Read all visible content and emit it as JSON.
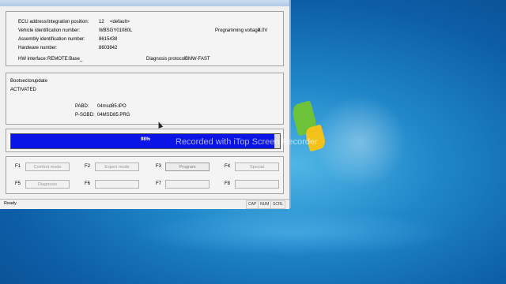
{
  "ecu_info": {
    "ecu_address_label": "ECU address/integration position:",
    "ecu_address_value": "12",
    "ecu_address_default": "<default>",
    "vin_label": "Vehicle identification number:",
    "vin_value": "WBSGY01080L",
    "assembly_label": "Assembly identification number:",
    "assembly_value": "8615438",
    "hardware_label": "Hardware number:",
    "hardware_value": "8603842",
    "hw_interface_label": "HW interface:",
    "hw_interface_value": "REMOTE:Base_",
    "programming_voltage_label": "Programming voltage:",
    "programming_voltage_value": "0.0V",
    "diagnosis_protocol_label": "Diagnosis protocol:",
    "diagnosis_protocol_value": "BMW-FAST"
  },
  "bootsector": {
    "title": "Bootsectorupdate",
    "status": "ACTIVATED",
    "pabd_label": "PABD:",
    "pabd_value": "04msd85.IPO",
    "psgbd_label": "P-SGBD:",
    "psgbd_value": "04MSD85.PRG"
  },
  "progress": {
    "percent": 98,
    "label": "98%"
  },
  "function_keys": [
    {
      "key": "F1",
      "label": "Comfort mode"
    },
    {
      "key": "F2",
      "label": "Expert mode"
    },
    {
      "key": "F3",
      "label": "Program"
    },
    {
      "key": "F4",
      "label": "Special"
    },
    {
      "key": "F5",
      "label": "Diagnosis"
    },
    {
      "key": "F6",
      "label": ""
    },
    {
      "key": "F7",
      "label": ""
    },
    {
      "key": "F8",
      "label": ""
    }
  ],
  "statusbar": {
    "status": "Ready",
    "caps": "CAP",
    "num": "NUM",
    "scroll": "SCRL"
  },
  "overlay": {
    "watermark": "Recorded with iTop Screen Recorder"
  },
  "colors": {
    "progress_fill": "#0a14e6",
    "desktop": "#1f86c9"
  }
}
